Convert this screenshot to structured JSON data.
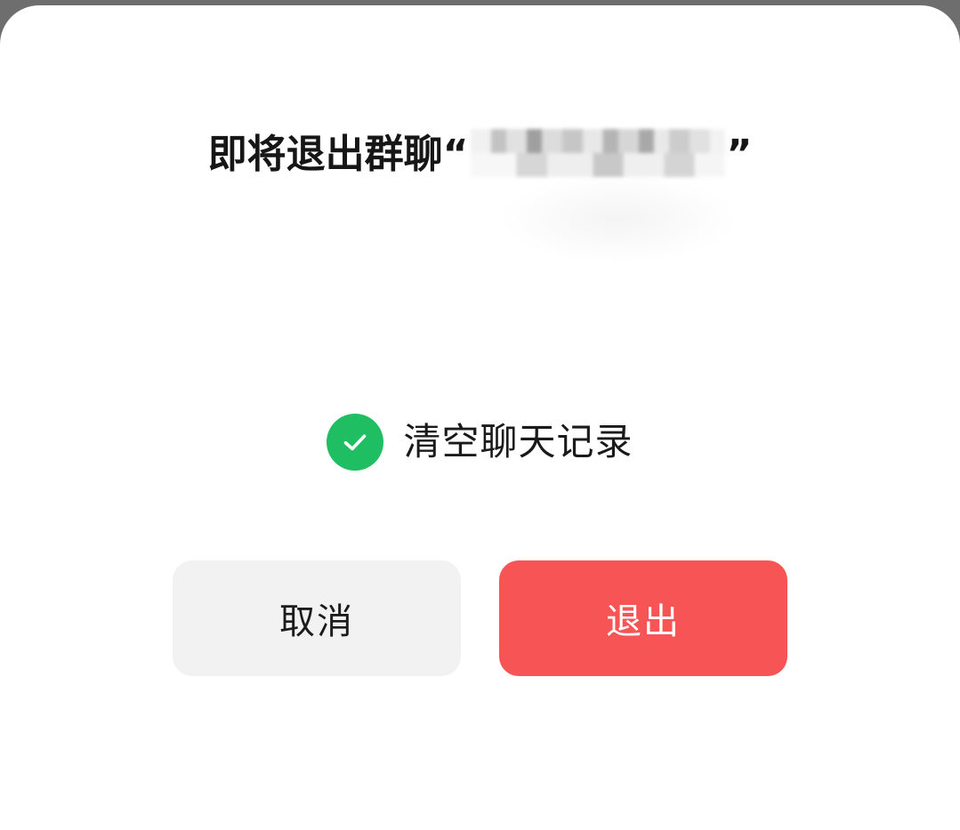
{
  "dialog": {
    "title_prefix": "即将退出群聊",
    "open_quote": "“",
    "close_quote": "”",
    "option_label": "清空聊天记录",
    "option_checked": true,
    "cancel_label": "取消",
    "exit_label": "退出"
  },
  "colors": {
    "accent_green": "#1fbe62",
    "danger_red": "#f75555",
    "cancel_bg": "#f2f2f2"
  },
  "icons": {
    "checkbox": "check-circle-icon"
  }
}
